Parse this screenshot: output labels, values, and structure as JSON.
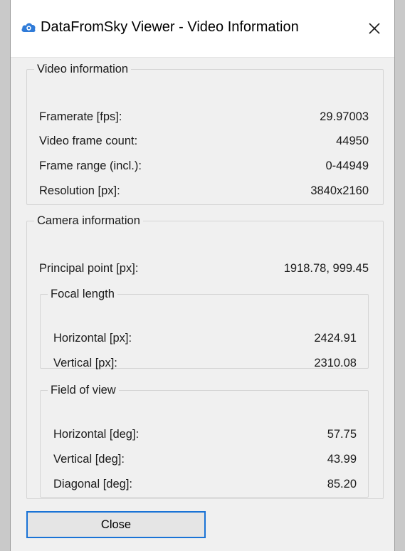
{
  "window": {
    "title": "DataFromSky Viewer - Video Information",
    "close_glyph": "✕",
    "icon": "cloud-icon"
  },
  "video": {
    "legend": "Video information",
    "rows": [
      {
        "label": "Framerate [fps]:",
        "value": "29.97003"
      },
      {
        "label": "Video frame count:",
        "value": "44950"
      },
      {
        "label": "Frame range (incl.):",
        "value": "0-44949"
      },
      {
        "label": "Resolution [px]:",
        "value": "3840x2160"
      }
    ]
  },
  "camera": {
    "legend": "Camera information",
    "principal_label": "Principal point [px]:",
    "principal_value": "1918.78, 999.45",
    "focal": {
      "legend": "Focal length",
      "rows": [
        {
          "label": "Horizontal [px]:",
          "value": "2424.91"
        },
        {
          "label": "Vertical [px]:",
          "value": "2310.08"
        }
      ]
    },
    "fov": {
      "legend": "Field of view",
      "rows": [
        {
          "label": "Horizontal [deg]:",
          "value": "57.75"
        },
        {
          "label": "Vertical [deg]:",
          "value": "43.99"
        },
        {
          "label": "Diagonal [deg]:",
          "value": "85.20"
        }
      ]
    }
  },
  "footer": {
    "close_label": "Close"
  },
  "colors": {
    "accent": "#1a73d6",
    "icon_blue": "#2f7bd8"
  }
}
